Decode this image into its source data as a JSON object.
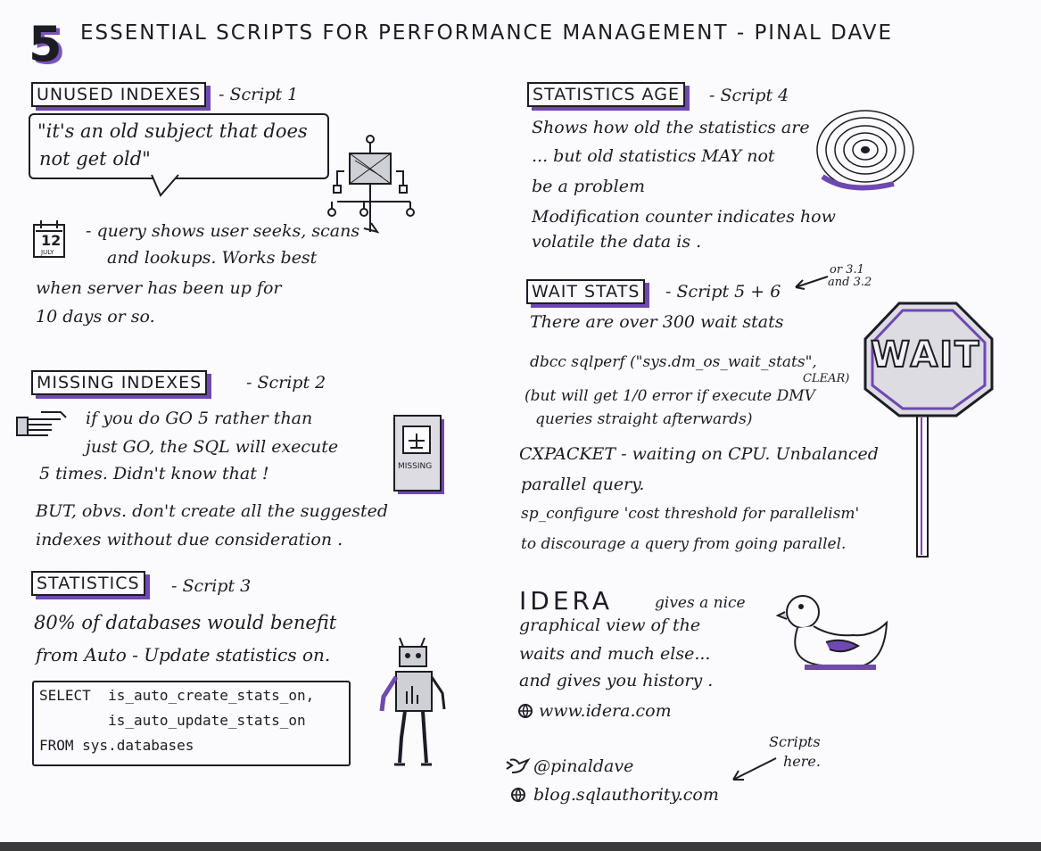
{
  "title": {
    "number": "5",
    "text": "ESSENTIAL SCRIPTS FOR PERFORMANCE MANAGEMENT - PINAL DAVE"
  },
  "left": {
    "unused": {
      "heading": "UNUSED INDEXES",
      "script": "- Script 1",
      "quote_line1": "\"it's an old subject that does",
      "quote_line2": "not get old\"",
      "calendar_day": "12",
      "calendar_month": "JULY",
      "lines": [
        "- query shows user seeks, scans",
        "and lookups. Works best",
        "when server has been up for",
        "10 days or so."
      ]
    },
    "missing": {
      "heading": "MISSING INDEXES",
      "script": "- Script 2",
      "book_label": "MISSING",
      "lines": [
        "if you do GO 5 rather than",
        "just GO, the SQL will execute",
        "5 times. Didn't know that !",
        "BUT, obvs. don't create all the suggested",
        "indexes without due consideration ."
      ]
    },
    "statistics": {
      "heading": "STATISTICS",
      "script": "- Script 3",
      "lines": [
        "80% of databases would benefit",
        "from Auto - Update statistics on."
      ],
      "code": [
        "SELECT  is_auto_create_stats_on,",
        "        is_auto_update_stats_on",
        "FROM sys.databases"
      ]
    }
  },
  "right": {
    "age": {
      "heading": "STATISTICS AGE",
      "script": "- Script 4",
      "lines": [
        "Shows how old the statistics are",
        "... but old statistics MAY not",
        "be a problem",
        "Modification counter indicates how",
        "volatile the data is ."
      ]
    },
    "wait": {
      "heading": "WAIT STATS",
      "script": "- Script 5 + 6",
      "aside": "or 3.1",
      "aside2": "and 3.2",
      "sign": "WAIT",
      "lines": [
        "There are over 300 wait stats",
        "dbcc sqlperf (\"sys.dm_os_wait_stats\",",
        "CLEAR)",
        "(but will get 1/0 error if execute DMV",
        "queries straight afterwards)",
        "CXPACKET - waiting on CPU. Unbalanced",
        "parallel query.",
        "sp_configure 'cost threshold for parallelism'",
        "to discourage a query from going parallel."
      ]
    },
    "idera": {
      "brand": "IDERA",
      "lines": [
        "gives a nice",
        "graphical view of the",
        "waits and much else...",
        "and gives you history ."
      ],
      "url": "www.idera.com"
    },
    "footer": {
      "twitter": "@pinaldave",
      "blog": "blog.sqlauthority.com",
      "note_line1": "Scripts",
      "note_line2": "here."
    }
  },
  "colors": {
    "accent": "#6f48b0",
    "ink": "#1c1c24",
    "paper": "#fbfafc"
  }
}
